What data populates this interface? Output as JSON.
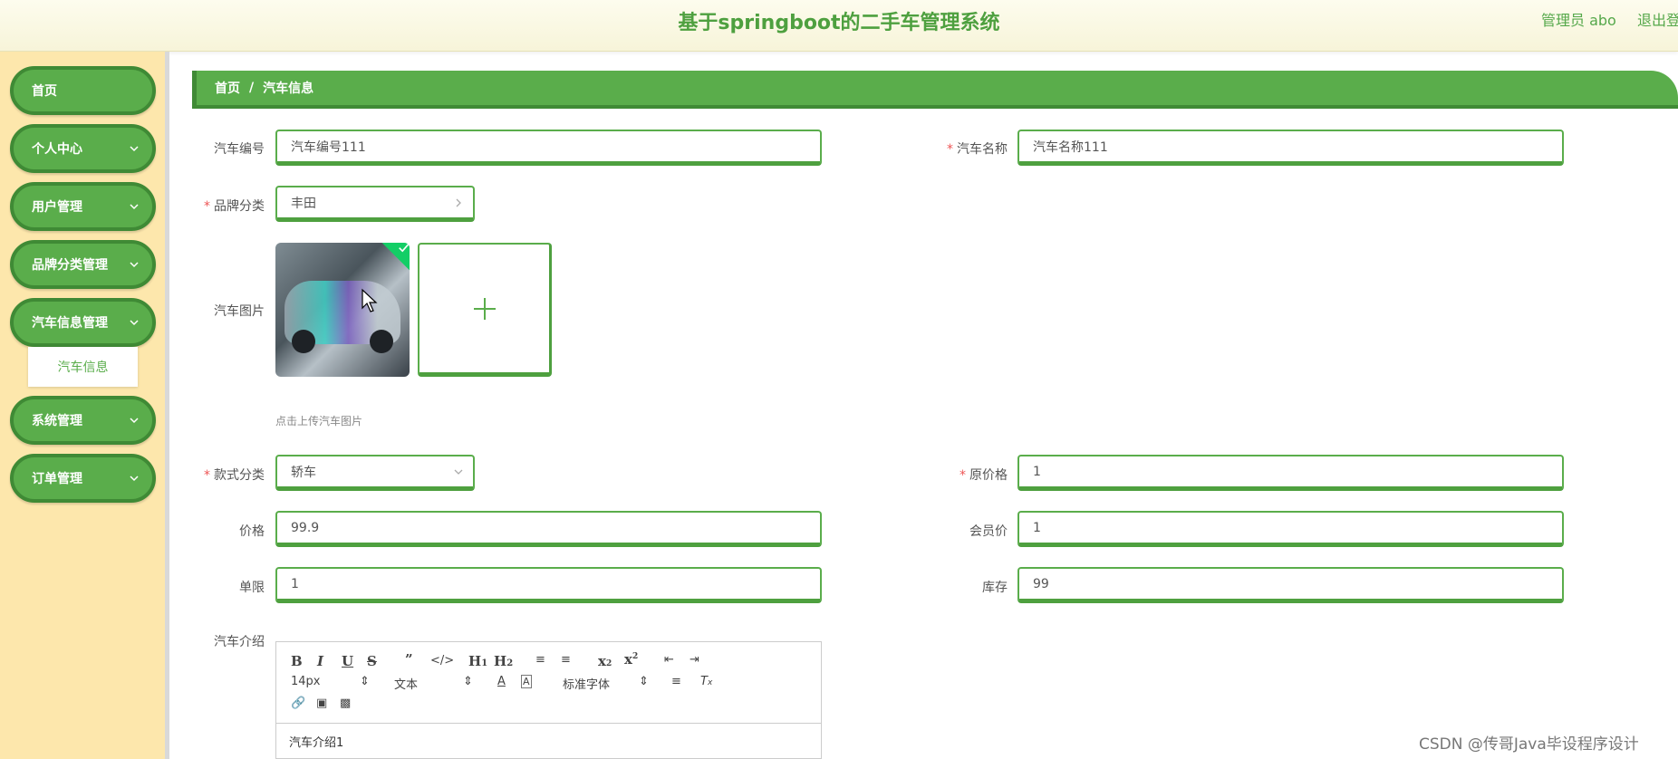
{
  "header": {
    "title": "基于springboot的二手车管理系统",
    "admin": "管理员 abo",
    "logout": "退出登"
  },
  "sidebar": {
    "items": [
      {
        "label": "首页"
      },
      {
        "label": "个人中心"
      },
      {
        "label": "用户管理"
      },
      {
        "label": "品牌分类管理"
      },
      {
        "label": "汽车信息管理"
      },
      {
        "label": "系统管理"
      },
      {
        "label": "订单管理"
      }
    ],
    "subitem": "汽车信息"
  },
  "breadcrumb": {
    "home": "首页",
    "sep": "/",
    "current": "汽车信息"
  },
  "form": {
    "car_no": {
      "label": "汽车编号",
      "value": "汽车编号111"
    },
    "car_name": {
      "label": "汽车名称",
      "value": "汽车名称111"
    },
    "brand": {
      "label": "品牌分类",
      "value": "丰田"
    },
    "image": {
      "label": "汽车图片",
      "hint": "点击上传汽车图片"
    },
    "style": {
      "label": "款式分类",
      "value": "轿车"
    },
    "orig_price": {
      "label": "原价格",
      "value": "1"
    },
    "price": {
      "label": "价格",
      "value": "99.9"
    },
    "member_price": {
      "label": "会员价",
      "value": "1"
    },
    "limit": {
      "label": "单限",
      "value": "1"
    },
    "stock": {
      "label": "库存",
      "value": "99"
    },
    "intro": {
      "label": "汽车介绍",
      "value": "汽车介绍1"
    }
  },
  "editor": {
    "font_size": "14px",
    "text_type": "文本",
    "font_family": "标准字体"
  },
  "watermark": "CSDN @传哥Java毕设程序设计",
  "colors": {
    "primary": "#5aad4b",
    "primary_dark": "#3f8a35",
    "sidebar_bg": "#fde7ac",
    "title": "#4ea03f"
  }
}
